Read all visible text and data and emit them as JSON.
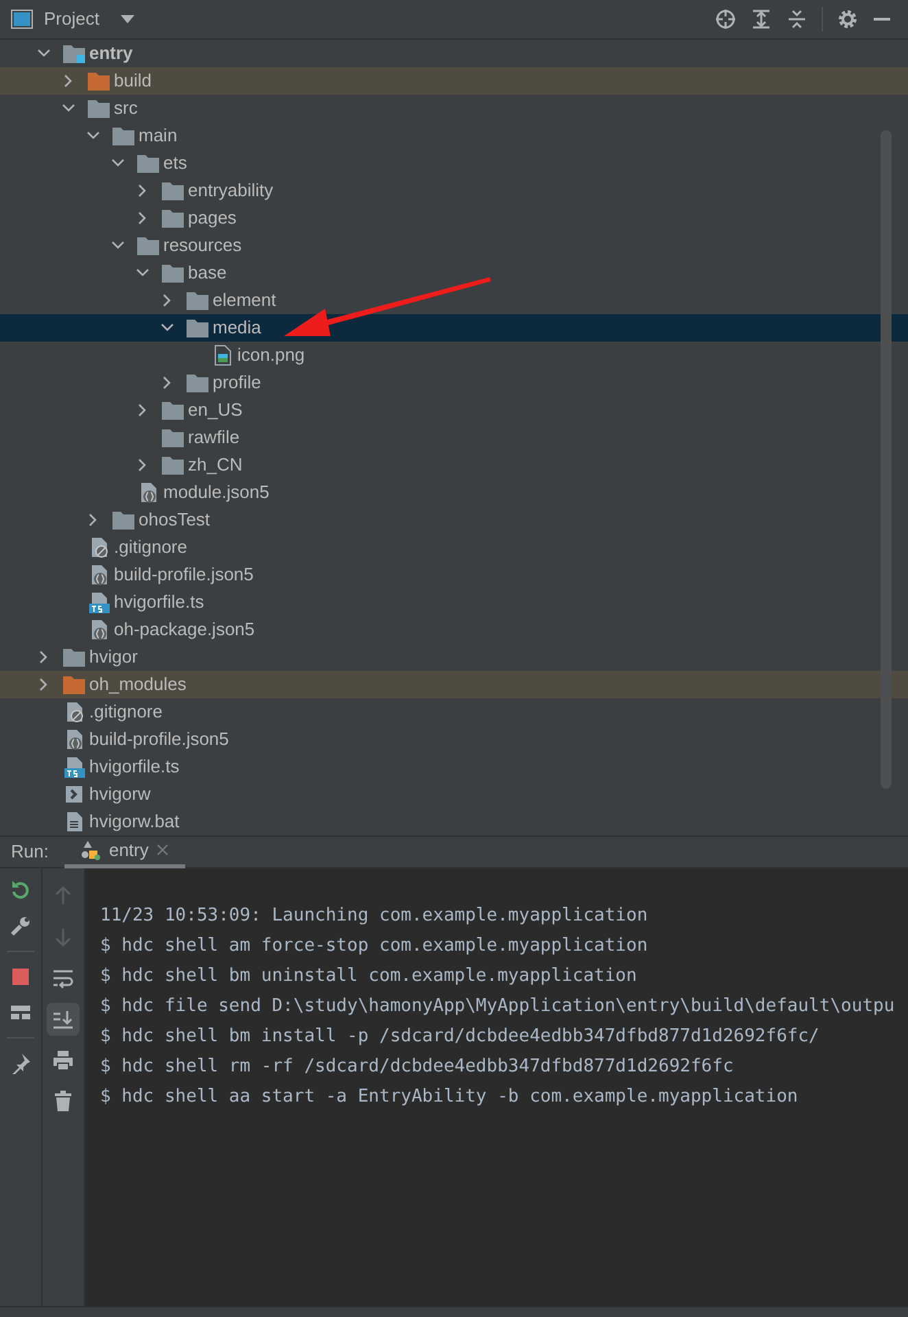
{
  "project_panel": {
    "title": "Project",
    "tree": [
      {
        "label": "entry",
        "kind": "module",
        "expanded": true,
        "selected": false,
        "children": [
          {
            "label": "build",
            "kind": "excluded_folder",
            "expanded": false,
            "selected": false
          },
          {
            "label": "src",
            "kind": "folder",
            "expanded": true,
            "selected": false,
            "children": [
              {
                "label": "main",
                "kind": "folder",
                "expanded": true,
                "selected": false,
                "children": [
                  {
                    "label": "ets",
                    "kind": "folder",
                    "expanded": true,
                    "selected": false,
                    "children": [
                      {
                        "label": "entryability",
                        "kind": "folder",
                        "expanded": false,
                        "selected": false
                      },
                      {
                        "label": "pages",
                        "kind": "folder",
                        "expanded": false,
                        "selected": false
                      }
                    ]
                  },
                  {
                    "label": "resources",
                    "kind": "folder",
                    "expanded": true,
                    "selected": false,
                    "children": [
                      {
                        "label": "base",
                        "kind": "folder",
                        "expanded": true,
                        "selected": false,
                        "children": [
                          {
                            "label": "element",
                            "kind": "folder",
                            "expanded": false,
                            "selected": false
                          },
                          {
                            "label": "media",
                            "kind": "folder",
                            "expanded": true,
                            "selected": true,
                            "children": [
                              {
                                "label": "icon.png",
                                "kind": "image",
                                "selected": false
                              }
                            ]
                          },
                          {
                            "label": "profile",
                            "kind": "folder",
                            "expanded": false,
                            "selected": false
                          }
                        ]
                      },
                      {
                        "label": "en_US",
                        "kind": "folder",
                        "expanded": false,
                        "selected": false
                      },
                      {
                        "label": "rawfile",
                        "kind": "folder",
                        "selected": false
                      },
                      {
                        "label": "zh_CN",
                        "kind": "folder",
                        "expanded": false,
                        "selected": false
                      }
                    ]
                  },
                  {
                    "label": "module.json5",
                    "kind": "json",
                    "selected": false
                  }
                ]
              },
              {
                "label": "ohosTest",
                "kind": "folder",
                "expanded": false,
                "selected": false
              }
            ]
          },
          {
            "label": ".gitignore",
            "kind": "gitignore",
            "selected": false
          },
          {
            "label": "build-profile.json5",
            "kind": "json",
            "selected": false
          },
          {
            "label": "hvigorfile.ts",
            "kind": "ts",
            "selected": false
          },
          {
            "label": "oh-package.json5",
            "kind": "json",
            "selected": false
          }
        ]
      },
      {
        "label": "hvigor",
        "kind": "folder",
        "expanded": false,
        "selected": false
      },
      {
        "label": "oh_modules",
        "kind": "excluded_folder",
        "expanded": false,
        "selected": false
      },
      {
        "label": ".gitignore",
        "kind": "gitignore",
        "selected": false
      },
      {
        "label": "build-profile.json5",
        "kind": "json",
        "selected": false
      },
      {
        "label": "hvigorfile.ts",
        "kind": "ts",
        "selected": false
      },
      {
        "label": "hvigorw",
        "kind": "script",
        "selected": false
      },
      {
        "label": "hvigorw.bat",
        "kind": "text",
        "selected": false
      }
    ],
    "annotation": {
      "kind": "arrow"
    }
  },
  "run_panel": {
    "label": "Run:",
    "tabs": [
      {
        "label": "entry",
        "selected": true
      }
    ],
    "actions": [
      {
        "kind": "rerun"
      },
      {
        "kind": "wrench"
      },
      {
        "kind": "stop"
      },
      {
        "kind": "layout"
      },
      {
        "kind": "pin"
      }
    ],
    "console_tools": [
      {
        "kind": "up",
        "disabled": true,
        "on": false
      },
      {
        "kind": "down",
        "disabled": true,
        "on": false
      },
      {
        "kind": "wrap",
        "disabled": false,
        "on": false
      },
      {
        "kind": "scroll_end",
        "disabled": false,
        "on": true
      },
      {
        "kind": "print",
        "disabled": false,
        "on": false
      },
      {
        "kind": "trash",
        "disabled": false,
        "on": false
      }
    ],
    "console_lines": [
      "11/23 10:53:09: Launching com.example.myapplication",
      "$ hdc shell am force-stop com.example.myapplication",
      "$ hdc shell bm uninstall com.example.myapplication",
      "$ hdc file send D:\\study\\hamonyApp\\MyApplication\\entry\\build\\default\\outpu",
      "$ hdc shell bm install -p /sdcard/dcbdee4edbb347dfbd877d1d2692f6fc/",
      "$ hdc shell rm -rf /sdcard/dcbdee4edbb347dfbd877d1d2692f6fc",
      "$ hdc shell aa start -a EntryAbility -b com.example.myapplication"
    ]
  }
}
